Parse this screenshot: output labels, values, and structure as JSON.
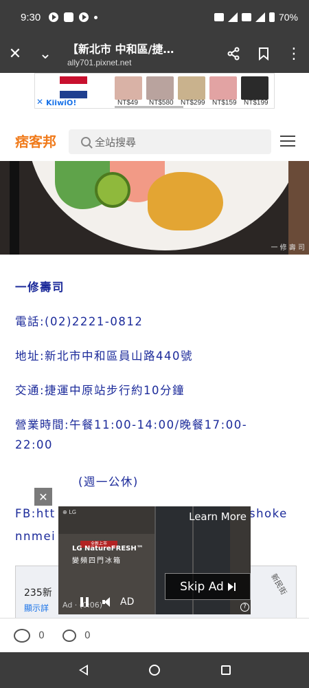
{
  "status_bar": {
    "time": "9:30",
    "battery": "70%"
  },
  "browser": {
    "page_title": "【新北市 中和區/捷…",
    "url": "ally701.pixnet.net",
    "close_glyph": "✕",
    "collapse_glyph": "⌄",
    "share_glyph": "⋖",
    "bookmark_glyph": "⌑",
    "menu_glyph": "⋮"
  },
  "top_ad": {
    "brand": "KiiwiO!",
    "close_glyph": "✕",
    "products": [
      {
        "price": "NT$49",
        "color": "#d9b2a6"
      },
      {
        "price": "NT$580",
        "color": "#b9a39e"
      },
      {
        "price": "NT$299",
        "color": "#c9b28d"
      },
      {
        "price": "NT$159",
        "color": "#e2a3a3"
      },
      {
        "price": "NT$199",
        "color": "#2a2a2a"
      }
    ]
  },
  "site_header": {
    "logo": "痞客邦",
    "search_placeholder": "全站搜尋"
  },
  "hero": {
    "caption": "一 修 壽 司"
  },
  "article": {
    "lines": [
      "一修壽司",
      "電話:(02)2221-0812",
      "地址:新北市中和區員山路440號",
      "交通:捷運中原站步行約10分鐘",
      "營業時間:午餐11:00-14:00/晚餐17:00-",
      "22:00",
      "(週一公休)",
      "FB:htt",
      "shoke",
      "nnmei"
    ]
  },
  "map_card": {
    "name": "235新",
    "link": "顯示詳",
    "road": "新民街"
  },
  "video_ad": {
    "close_glyph": "✕",
    "lg_logo": "⊕ LG",
    "learn_more": "Learn More",
    "tag": "全新上市",
    "brand_line1": "LG NatureFRESH™",
    "brand_line2": "變頻四門冰箱",
    "skip_label": "Skip Ad",
    "ad_label": "AD",
    "ad_time": "Ad · (0:06)",
    "help_glyph": "?"
  },
  "action_bar": {
    "like_count": "0",
    "comment_count": "0"
  },
  "colors": {
    "chrome": "#3c3c3c",
    "article_text": "#1b2a9a",
    "brand_orange": "#f07a1a"
  },
  "icons": [
    "close-icon",
    "collapse-icon",
    "share-icon",
    "bookmark-icon",
    "more-icon",
    "search-icon",
    "hamburger-icon",
    "skip-icon",
    "pause-icon",
    "mute-icon",
    "emoji-icon",
    "comment-icon",
    "back-icon",
    "home-icon",
    "recents-icon"
  ]
}
